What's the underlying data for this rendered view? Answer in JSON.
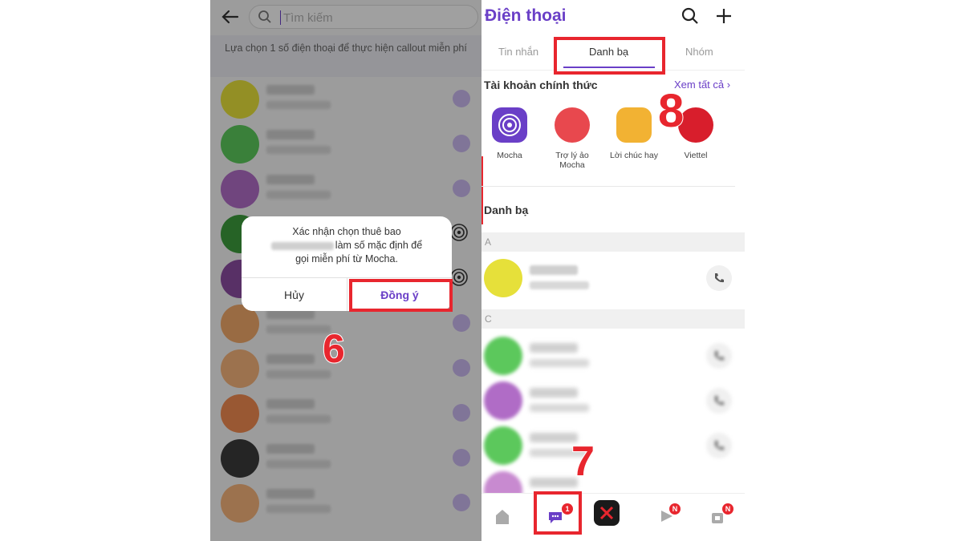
{
  "left": {
    "search_placeholder": "Tìm kiếm",
    "hint": "Lựa chọn 1 số điện thoại để thực hiện callout miễn phí",
    "dialog": {
      "line1": "Xác nhận chọn thuê bao",
      "line2": "làm số mặc định để",
      "line3": "gọi miễn phí từ Mocha.",
      "cancel": "Hủy",
      "confirm": "Đồng ý"
    }
  },
  "right": {
    "title": "Điện thoại",
    "tabs": [
      "Tin nhắn",
      "Danh bạ",
      "Nhóm"
    ],
    "official_title": "Tài khoản chính thức",
    "see_all": "Xem tất cả",
    "official_accounts": [
      {
        "label": "Mocha",
        "color": "#6a3fc7"
      },
      {
        "label": "Trợ lý ảo Mocha",
        "color": "#e8484e"
      },
      {
        "label": "Lời chúc hay",
        "color": "#f2b233"
      },
      {
        "label": "Viettel",
        "color": "#d81e2c"
      }
    ],
    "contacts_title": "Danh bạ",
    "sections": [
      "A",
      "C"
    ],
    "chat_badge": "1",
    "new_badge": "N"
  },
  "steps": {
    "s6": "6",
    "s7": "7",
    "s8": "8"
  }
}
